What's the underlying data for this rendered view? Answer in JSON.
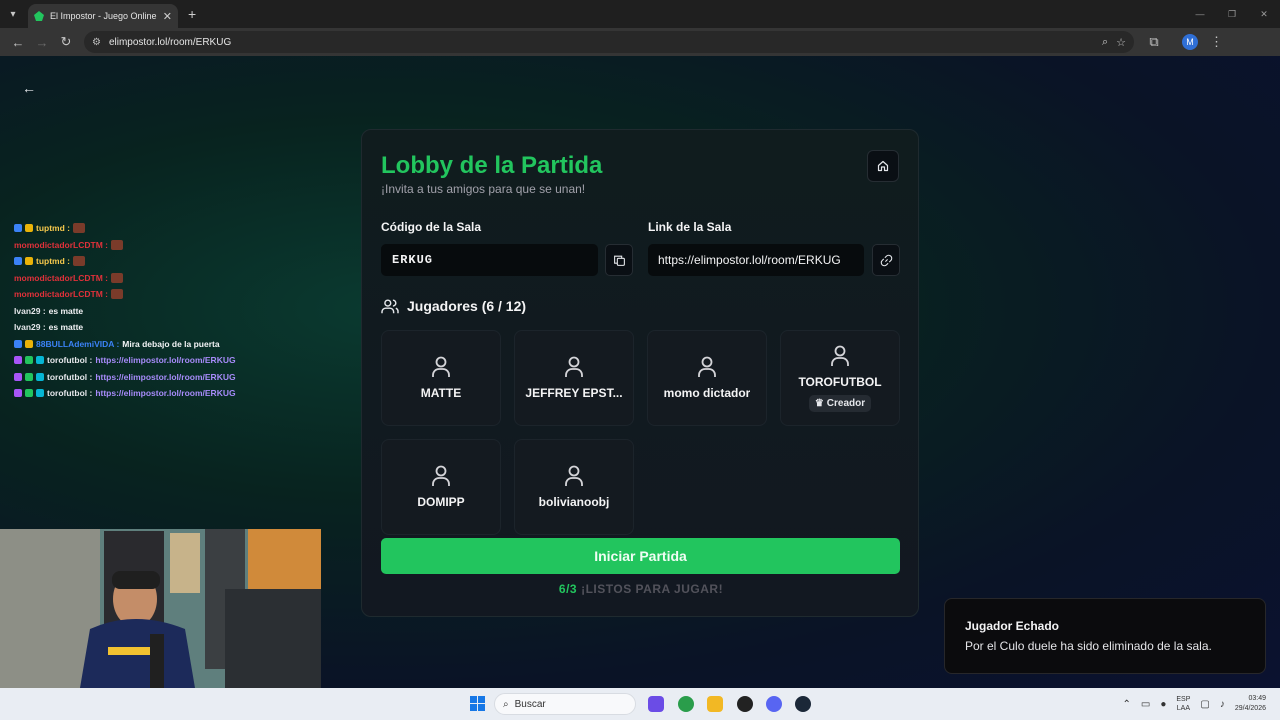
{
  "browser": {
    "tab_title": "El Impostor - Juego Online Gra",
    "url": "elimpostor.lol/room/ERKUG"
  },
  "chat": [
    {
      "user": "tuptmd :",
      "color": "#f5c84c",
      "msg": "",
      "badges": [
        "b-blue",
        "b-yel"
      ],
      "emote": true,
      "link": false
    },
    {
      "user": "momodictadorLCDTM :",
      "color": "#e0313a",
      "msg": "",
      "badges": [],
      "emote": true,
      "link": false
    },
    {
      "user": "tuptmd :",
      "color": "#f5c84c",
      "msg": "",
      "badges": [
        "b-blue",
        "b-yel"
      ],
      "emote": true,
      "link": false
    },
    {
      "user": "momodictadorLCDTM :",
      "color": "#e0313a",
      "msg": "",
      "badges": [],
      "emote": true,
      "link": false
    },
    {
      "user": "momodictadorLCDTM :",
      "color": "#e0313a",
      "msg": "",
      "badges": [],
      "emote": true,
      "link": false
    },
    {
      "user": "Ivan29 :",
      "color": "#e5e7eb",
      "msg": "es matte",
      "badges": [],
      "emote": false,
      "link": false
    },
    {
      "user": "Ivan29 :",
      "color": "#e5e7eb",
      "msg": "es matte",
      "badges": [],
      "emote": false,
      "link": false
    },
    {
      "user": "88BULLAdemiVIDA :",
      "color": "#3b82f6",
      "msg": "Mira debajo de la puerta",
      "badges": [
        "b-blue",
        "b-yel"
      ],
      "emote": false,
      "link": false
    },
    {
      "user": "torofutbol :",
      "color": "#e5e7eb",
      "msg": "https://elimpostor.lol/room/ERKUG",
      "badges": [
        "b-purp",
        "b-grn",
        "b-cyan"
      ],
      "emote": false,
      "link": true
    },
    {
      "user": "torofutbol :",
      "color": "#e5e7eb",
      "msg": "https://elimpostor.lol/room/ERKUG",
      "badges": [
        "b-purp",
        "b-grn",
        "b-cyan"
      ],
      "emote": false,
      "link": true
    },
    {
      "user": "torofutbol :",
      "color": "#e5e7eb",
      "msg": "https://elimpostor.lol/room/ERKUG",
      "badges": [
        "b-purp",
        "b-grn",
        "b-cyan"
      ],
      "emote": false,
      "link": true
    }
  ],
  "lobby": {
    "title": "Lobby de la Partida",
    "subtitle": "¡Invita a tus amigos para que se unan!",
    "code_label": "Código de la Sala",
    "code_value": "ERKUG",
    "link_label": "Link de la Sala",
    "link_value": "https://elimpostor.lol/room/ERKUG",
    "players_heading": "Jugadores (6 / 12)",
    "creator_label": "Creador",
    "players": [
      "MATTE",
      "JEFFREY EPST...",
      "momo dictador",
      "TOROFUTBOL",
      "DOMIPP",
      "bolivianoobj"
    ],
    "creator_index": 3,
    "start_label": "Iniciar Partida",
    "ready_count": "6/3",
    "ready_text": "¡LISTOS PARA JUGAR!"
  },
  "toast": {
    "title": "Jugador Echado",
    "message": "Por el Culo duele ha sido eliminado de la sala."
  },
  "taskbar": {
    "search_placeholder": "Buscar",
    "lang_top": "ESP",
    "lang_bottom": "LAA",
    "time": "03:49",
    "date": "29/4/2026"
  }
}
